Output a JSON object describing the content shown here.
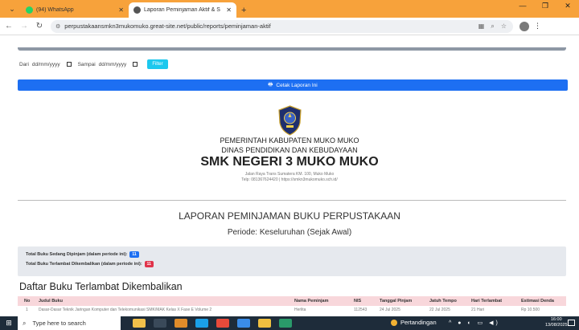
{
  "browser": {
    "tabs": [
      {
        "label": "(94) WhatsApp",
        "active": false,
        "icon": "whatsapp-icon"
      },
      {
        "label": "Laporan Peminjaman Aktif & S",
        "active": true,
        "icon": "site-icon"
      }
    ],
    "new_tab": "+",
    "url": "perpustakaansmkn3mukomuko.great-site.net/public/reports/peminjaman-aktif",
    "accent": "#f7a23b"
  },
  "filters": {
    "dari_label": "Dari",
    "sampai_label": "Sampai",
    "date_placeholder": "dd/mm/yyyy",
    "filter_button": "Filter"
  },
  "cetak_button": "Cetak Laporan Ini",
  "kop": {
    "line1": "PEMERINTAH KABUPATEN MUKO MUKO",
    "line2": "DINAS PENDIDIKAN DAN KEBUDAYAAN",
    "school": "SMK NEGERI 3 MUKO MUKO",
    "address": "Jalan Raya Trans Sumatera KM. 100, Muko Muko",
    "contact": "Telp: 081367624420 | https://smkn3mukomuko.sch.id/"
  },
  "report": {
    "title": "LAPORAN PEMINJAMAN BUKU PERPUSTAKAAN",
    "periode": "Periode: Keseluruhan (Sejak Awal)"
  },
  "summary": {
    "dipinjam_label": "Total Buku Sedang Dipinjam (dalam periode ini):",
    "dipinjam_value": "11",
    "terlambat_label": "Total Buku Terlambat Dikembalikan (dalam periode ini):",
    "terlambat_value": "11"
  },
  "section_title": "Daftar Buku Terlambat Dikembalikan",
  "table": {
    "headers": [
      "No",
      "Judul Buku",
      "Nama Peminjam",
      "NIS",
      "Tanggal Pinjam",
      "Jatuh Tempo",
      "Hari Terlambat",
      "Estimasi Denda"
    ],
    "first_row": [
      "1",
      "Dasar-Dasar Teknik Jaringan Komputer dan Telekomunikasi SMK/MAK Kelas X Fase E Volume 2",
      "Herlita",
      "112543",
      "24 Jul 2025",
      "22 Jul 2025",
      "21 Hari",
      "Rp 10.500"
    ]
  },
  "taskbar": {
    "search_placeholder": "Type here to search",
    "weather": "Pertandingan",
    "time": "16:00",
    "date": "13/08/2025"
  }
}
